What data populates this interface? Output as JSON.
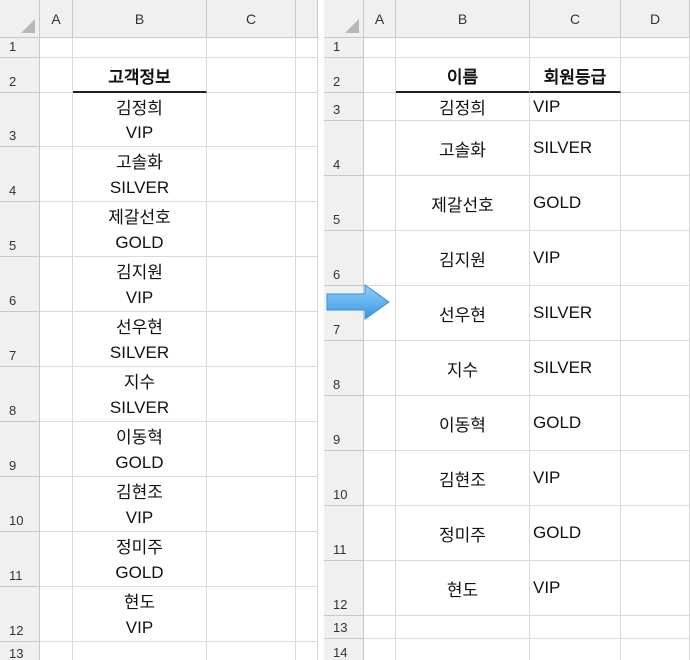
{
  "left_sheet": {
    "columns": [
      "A",
      "B",
      "C"
    ],
    "rows": [
      "1",
      "2",
      "3",
      "4",
      "5",
      "6",
      "7",
      "8",
      "9",
      "10",
      "11",
      "12",
      "13"
    ],
    "header": "고객정보",
    "records": [
      {
        "name": "김정희",
        "grade": "VIP"
      },
      {
        "name": "고솔화",
        "grade": "SILVER"
      },
      {
        "name": "제갈선호",
        "grade": "GOLD"
      },
      {
        "name": "김지원",
        "grade": "VIP"
      },
      {
        "name": "선우현",
        "grade": "SILVER"
      },
      {
        "name": "지수",
        "grade": "SILVER"
      },
      {
        "name": "이동혁",
        "grade": "GOLD"
      },
      {
        "name": "김현조",
        "grade": "VIP"
      },
      {
        "name": "정미주",
        "grade": "GOLD"
      },
      {
        "name": "현도",
        "grade": "VIP"
      }
    ]
  },
  "right_sheet": {
    "columns": [
      "A",
      "B",
      "C",
      "D"
    ],
    "rows": [
      "1",
      "2",
      "3",
      "4",
      "5",
      "6",
      "7",
      "8",
      "9",
      "10",
      "11",
      "12",
      "13",
      "14"
    ],
    "header_name": "이름",
    "header_grade": "회원등급",
    "records": [
      {
        "name": "김정희",
        "grade": "VIP"
      },
      {
        "name": "고솔화",
        "grade": "SILVER"
      },
      {
        "name": "제갈선호",
        "grade": "GOLD"
      },
      {
        "name": "김지원",
        "grade": "VIP"
      },
      {
        "name": "선우현",
        "grade": "SILVER"
      },
      {
        "name": "지수",
        "grade": "SILVER"
      },
      {
        "name": "이동혁",
        "grade": "GOLD"
      },
      {
        "name": "김현조",
        "grade": "VIP"
      },
      {
        "name": "정미주",
        "grade": "GOLD"
      },
      {
        "name": "현도",
        "grade": "VIP"
      }
    ]
  },
  "icons": {
    "transform_arrow": "arrow-right-icon"
  },
  "colors": {
    "arrow": "#4aa8e8",
    "header_bg": "#f0f0f0",
    "gridline": "#dadada"
  }
}
